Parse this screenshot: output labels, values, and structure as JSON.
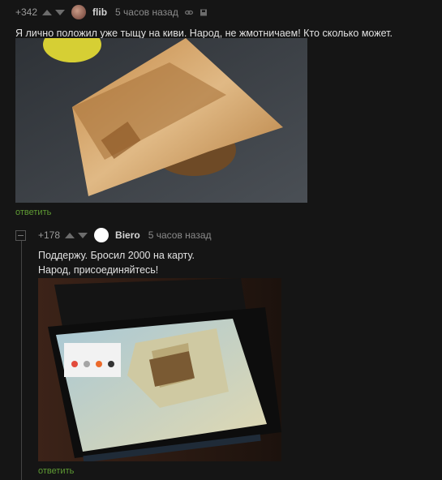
{
  "comments": [
    {
      "rating": "+342",
      "author": "flib",
      "time": "5 часов назад",
      "text": "Я лично положил уже тыщу на киви. Народ, не жмотничаем! Кто сколько может.",
      "reply_label": "ответить",
      "image_icon": "photo-kiwi-banknote"
    },
    {
      "rating": "+178",
      "author": "Biero",
      "time": "5 часов назад",
      "text_line1": "Поддержу. Бросил 2000 на карту.",
      "text_line2": "Народ, присоединяйтесь!",
      "reply_label": "ответить",
      "image_icon": "photo-laptop-map-banknote"
    }
  ],
  "colors": {
    "background": "#151515",
    "reply_link": "#5f9b34",
    "text": "#e2e2e2",
    "muted": "#8b8b8b"
  }
}
